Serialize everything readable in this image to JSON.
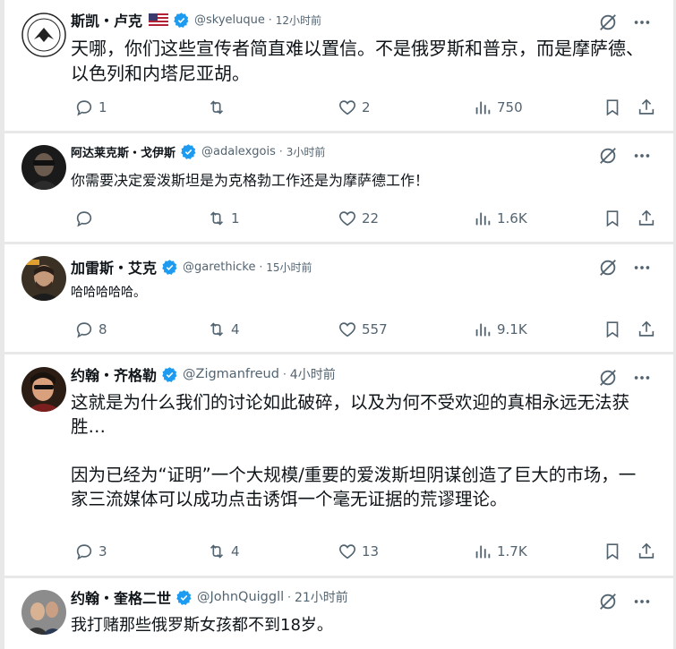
{
  "tweets": [
    {
      "name": "斯凯・卢克",
      "handle": "@skyeluque",
      "time": "12小时前",
      "text": "天哪，你们这些宣传者简直难以置信。不是俄罗斯和普京，而是摩萨德、以色列和内塔尼亚胡。",
      "replies": "1",
      "retweets": "",
      "likes": "2",
      "views": "750",
      "flag": "us-flag-icon"
    },
    {
      "name": "阿达莱克斯・戈伊斯",
      "handle": "@adalexgois",
      "time": "3小时前",
      "text": "你需要决定爱泼斯坦是为克格勃工作还是为摩萨德工作！",
      "replies": "",
      "retweets": "1",
      "likes": "22",
      "views": "1.6K"
    },
    {
      "name": "加雷斯・艾克",
      "handle": "@garethicke",
      "time": "15小时前",
      "text": "哈哈哈哈哈。",
      "replies": "8",
      "retweets": "4",
      "likes": "557",
      "views": "9.1K"
    },
    {
      "name": "约翰・齐格勒",
      "handle": "@Zigmanfreud",
      "time": "4小时前",
      "text": "这就是为什么我们的讨论如此破碎，以及为何不受欢迎的真相永远无法获胜…",
      "text2": "因为已经为“证明”一个大规模/重要的爱泼斯坦阴谋创造了巨大的市场，一家三流媒体可以成功点击诱饵一个毫无证据的荒谬理论。",
      "replies": "3",
      "retweets": "4",
      "likes": "13",
      "views": "1.7K"
    },
    {
      "name": "约翰・奎格二世",
      "handle": "@JohnQuiggll",
      "time": "21小时前",
      "text": "我打赌那些俄罗斯女孩都不到18岁。"
    }
  ],
  "separator": "·",
  "colors": {
    "verified": "#1d9bf0",
    "muted": "#536471",
    "text": "#0f1419"
  }
}
